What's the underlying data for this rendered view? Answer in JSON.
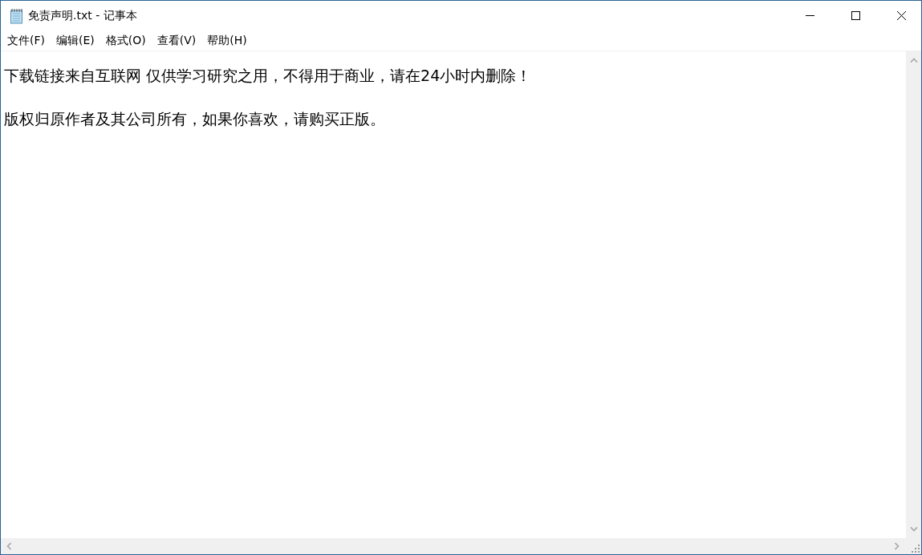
{
  "window": {
    "title": "免责声明.txt - 记事本"
  },
  "menu": [
    "文件(F)",
    "编辑(E)",
    "格式(O)",
    "查看(V)",
    "帮助(H)"
  ],
  "document": {
    "paragraphs": [
      "下载链接来自互联网 仅供学习研究之用，不得用于商业，请在24小时内删除！",
      "版权归原作者及其公司所有，如果你喜欢，请购买正版。"
    ]
  }
}
